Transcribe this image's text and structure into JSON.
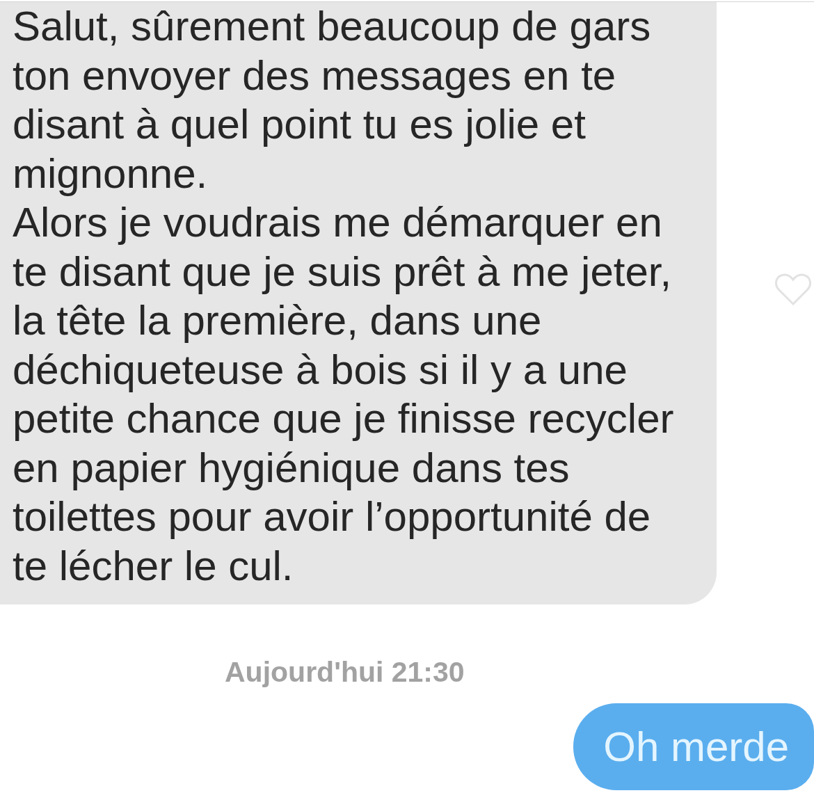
{
  "incoming_message": {
    "paragraphs": [
      "Salut, sûrement beaucoup de gars ton envoyer des messages en te disant à quel point tu es jolie et mignonne.",
      "Alors je voudrais me démarquer en te disant que je suis prêt à me jeter, la tête la première, dans une déchiqueteuse à bois si il y a une petite chance que je finisse recycler en papier hygiénique dans tes toilettes pour avoir l’opportunité de te lécher le cul."
    ],
    "liked": false
  },
  "timestamp": "Aujourd'hui 21:30",
  "outgoing_message": {
    "text": "Oh merde"
  }
}
